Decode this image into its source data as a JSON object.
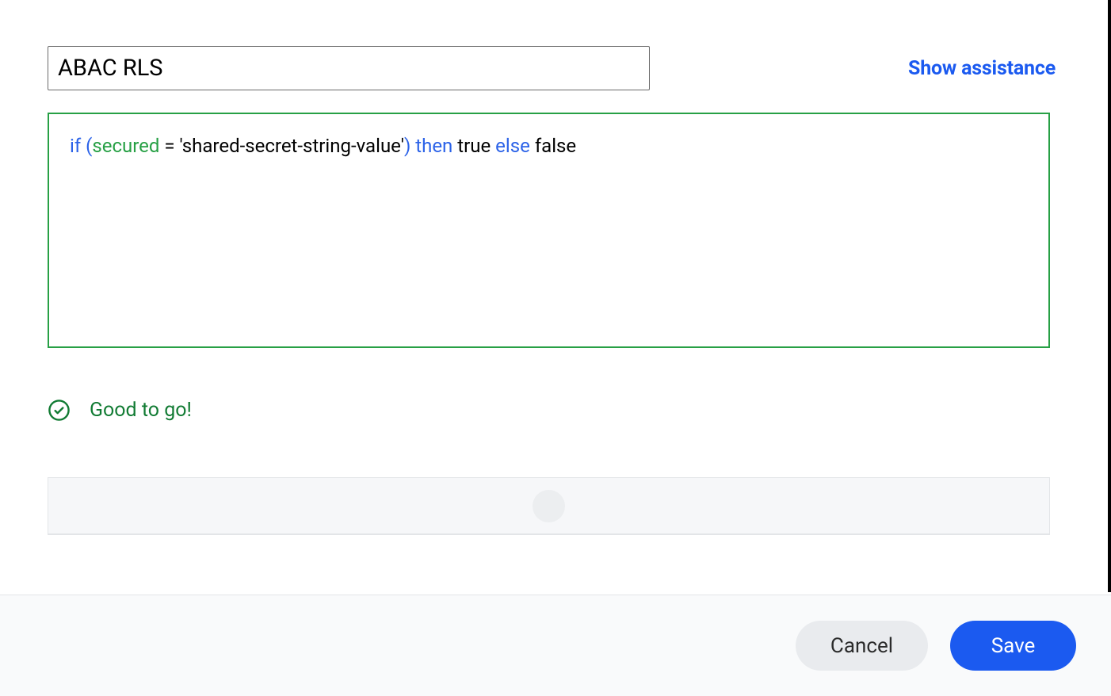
{
  "header": {
    "name_value": "ABAC RLS",
    "show_assistance_label": "Show assistance"
  },
  "editor": {
    "tokens": {
      "if": "if",
      "open_paren": "(",
      "field": "secured",
      "space1": " ",
      "eq": "=",
      "space2": " ",
      "string": "'shared-secret-string-value'",
      "close_paren": ")",
      "space3": " ",
      "then": "then",
      "space4": " ",
      "true": "true",
      "space5": " ",
      "else": "else",
      "space6": " ",
      "false": "false"
    }
  },
  "status": {
    "message": "Good to go!"
  },
  "footer": {
    "cancel_label": "Cancel",
    "save_label": "Save"
  }
}
